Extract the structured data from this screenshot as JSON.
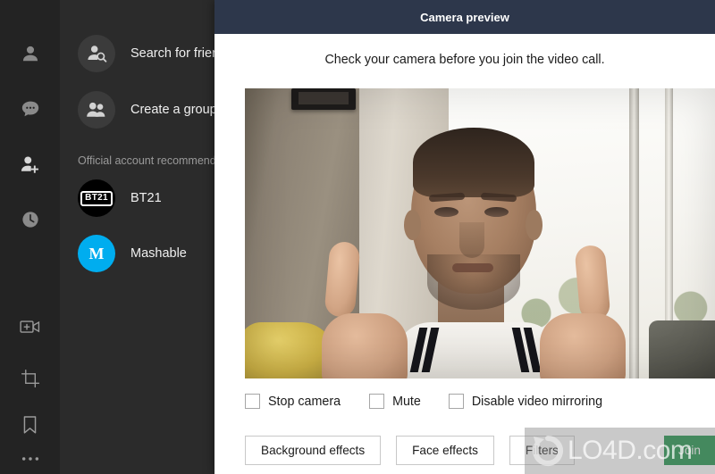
{
  "sidebar": {
    "rail_icons": [
      {
        "name": "profile-icon",
        "label": "Profile"
      },
      {
        "name": "chats-icon",
        "label": "Chats"
      },
      {
        "name": "add-contact-icon",
        "label": "Add contact"
      },
      {
        "name": "recent-icon",
        "label": "Recent"
      },
      {
        "name": "add-video-call-icon",
        "label": "New video call"
      },
      {
        "name": "crop-screenshot-icon",
        "label": "Screenshot"
      },
      {
        "name": "bookmark-icon",
        "label": "Bookmarks"
      },
      {
        "name": "more-options-icon",
        "label": "More"
      }
    ],
    "actions": [
      {
        "label": "Search for friends",
        "avatar": "search-person-icon"
      },
      {
        "label": "Create a group",
        "avatar": "group-person-icon"
      }
    ],
    "section_heading": "Official account recommendations",
    "accounts": [
      {
        "label": "BT21",
        "avatar_text": "BT21",
        "avatar_color": "#000000"
      },
      {
        "label": "Mashable",
        "avatar_text": "M",
        "avatar_color": "#00adef"
      }
    ]
  },
  "dialog": {
    "title": "Camera preview",
    "title_bar_color": "#2d374b",
    "subtitle": "Check your camera before you join the video call.",
    "video_preview_alt": "Live webcam preview showing a man giving two thumbs up in front of a bright window",
    "checkboxes": [
      {
        "label": "Stop camera",
        "checked": false
      },
      {
        "label": "Mute",
        "checked": false
      },
      {
        "label": "Disable video mirroring",
        "checked": false
      }
    ],
    "buttons": [
      {
        "label": "Background effects"
      },
      {
        "label": "Face effects"
      },
      {
        "label": "Filters"
      }
    ],
    "join_button": {
      "label": "Join",
      "color": "#0e8a3c"
    }
  },
  "watermark": {
    "text": "LO4D.com"
  }
}
